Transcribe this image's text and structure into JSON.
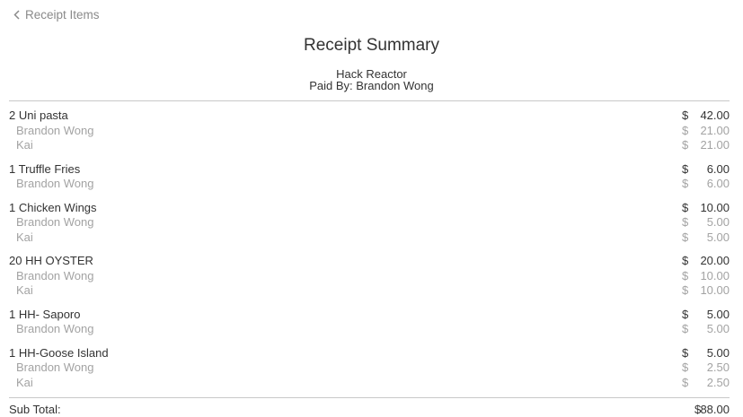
{
  "nav": {
    "back_label": "Receipt Items"
  },
  "header": {
    "title": "Receipt Summary",
    "restaurant": "Hack Reactor",
    "paid_by": "Paid By: Brandon Wong"
  },
  "currency": "$",
  "items": [
    {
      "label": "2 Uni pasta",
      "amount": "$42.00",
      "shares": [
        {
          "name": "Brandon Wong",
          "amount": "$21.00"
        },
        {
          "name": "Kai",
          "amount": "$21.00"
        }
      ]
    },
    {
      "label": "1 Truffle Fries",
      "amount": "$6.00",
      "shares": [
        {
          "name": "Brandon Wong",
          "amount": "$6.00"
        }
      ]
    },
    {
      "label": "1 Chicken Wings",
      "amount": "$10.00",
      "shares": [
        {
          "name": "Brandon Wong",
          "amount": "$5.00"
        },
        {
          "name": "Kai",
          "amount": "$5.00"
        }
      ]
    },
    {
      "label": "20 HH OYSTER",
      "amount": "$20.00",
      "shares": [
        {
          "name": "Brandon Wong",
          "amount": "$10.00"
        },
        {
          "name": "Kai",
          "amount": "$10.00"
        }
      ]
    },
    {
      "label": "1 HH- Saporo",
      "amount": "$5.00",
      "shares": [
        {
          "name": "Brandon Wong",
          "amount": "$5.00"
        }
      ]
    },
    {
      "label": "1 HH-Goose Island",
      "amount": "$5.00",
      "shares": [
        {
          "name": "Brandon Wong",
          "amount": "$2.50"
        },
        {
          "name": "Kai",
          "amount": "$2.50"
        }
      ]
    }
  ],
  "summary": {
    "subtotal_label": "Sub Total:",
    "subtotal_value": "88.00"
  }
}
